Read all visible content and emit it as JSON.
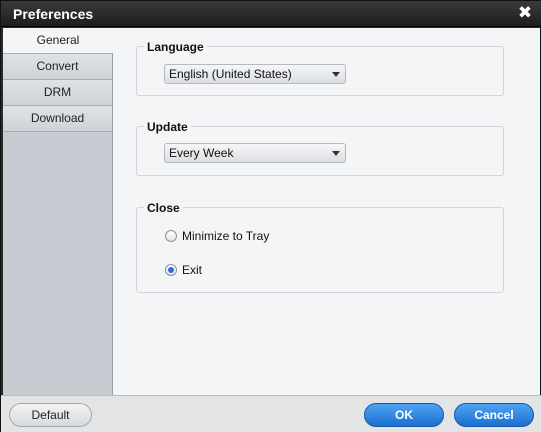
{
  "window": {
    "title": "Preferences"
  },
  "tabs": [
    {
      "label": "General",
      "active": true
    },
    {
      "label": "Convert",
      "active": false
    },
    {
      "label": "DRM",
      "active": false
    },
    {
      "label": "Download",
      "active": false
    }
  ],
  "general": {
    "language": {
      "title": "Language",
      "selected": "English (United States)"
    },
    "update": {
      "title": "Update",
      "selected": "Every Week"
    },
    "close": {
      "title": "Close",
      "options": [
        {
          "label": "Minimize to Tray",
          "checked": false
        },
        {
          "label": "Exit",
          "checked": true
        }
      ]
    }
  },
  "footer": {
    "default_label": "Default",
    "ok_label": "OK",
    "cancel_label": "Cancel"
  },
  "colors": {
    "accent": "#1a6fd0",
    "titlebar": "#1e1e1e",
    "content_bg": "#f4f5f6",
    "sidebar_bg": "#c8ccd2"
  }
}
